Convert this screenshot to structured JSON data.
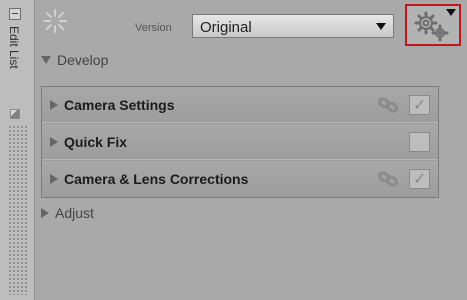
{
  "sidebar": {
    "title": "Edit List"
  },
  "header": {
    "version_label": "Version",
    "version_value": "Original"
  },
  "sections": {
    "develop": {
      "label": "Develop",
      "expanded": true
    },
    "adjust": {
      "label": "Adjust",
      "expanded": false
    }
  },
  "steps": [
    {
      "label": "Camera Settings",
      "linked": true,
      "checked": true
    },
    {
      "label": "Quick Fix",
      "linked": false,
      "checked": false
    },
    {
      "label": "Camera & Lens Corrections",
      "linked": true,
      "checked": true
    }
  ],
  "colors": {
    "highlight_border": "#c4151c",
    "panel_bg": "#a9a9a9"
  },
  "icons": [
    "collapse-icon",
    "spinner-icon",
    "gear-icon",
    "dropdown-caret-icon",
    "link-icon",
    "grip-icon"
  ]
}
